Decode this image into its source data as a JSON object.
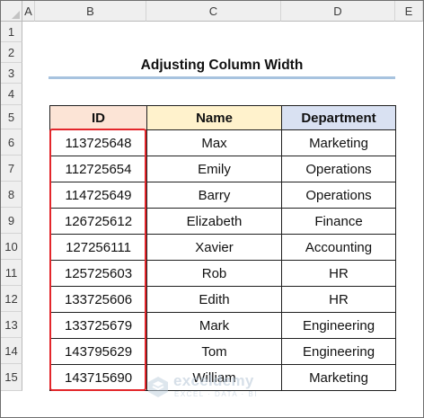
{
  "sheet": {
    "columns": [
      "A",
      "B",
      "C",
      "D",
      "E"
    ],
    "rows": [
      "1",
      "2",
      "3",
      "4",
      "5",
      "6",
      "7",
      "8",
      "9",
      "10",
      "11",
      "12",
      "13",
      "14",
      "15"
    ]
  },
  "title": "Adjusting Column Width",
  "table": {
    "headers": [
      "ID",
      "Name",
      "Department"
    ],
    "header_colors": [
      "#fce4d6",
      "#fff2cc",
      "#d9e1f2"
    ],
    "rows": [
      [
        "113725648",
        "Max",
        "Marketing"
      ],
      [
        "112725654",
        "Emily",
        "Operations"
      ],
      [
        "114725649",
        "Barry",
        "Operations"
      ],
      [
        "126725612",
        "Elizabeth",
        "Finance"
      ],
      [
        "127256111",
        "Xavier",
        "Accounting"
      ],
      [
        "125725603",
        "Rob",
        "HR"
      ],
      [
        "133725606",
        "Edith",
        "HR"
      ],
      [
        "133725679",
        "Mark",
        "Engineering"
      ],
      [
        "143795629",
        "Tom",
        "Engineering"
      ],
      [
        "143715690",
        "William",
        "Marketing"
      ]
    ]
  },
  "highlight_color": "#e3262b",
  "watermark": {
    "brand": "exceldemy",
    "tagline": "EXCEL · DATA · BI"
  }
}
